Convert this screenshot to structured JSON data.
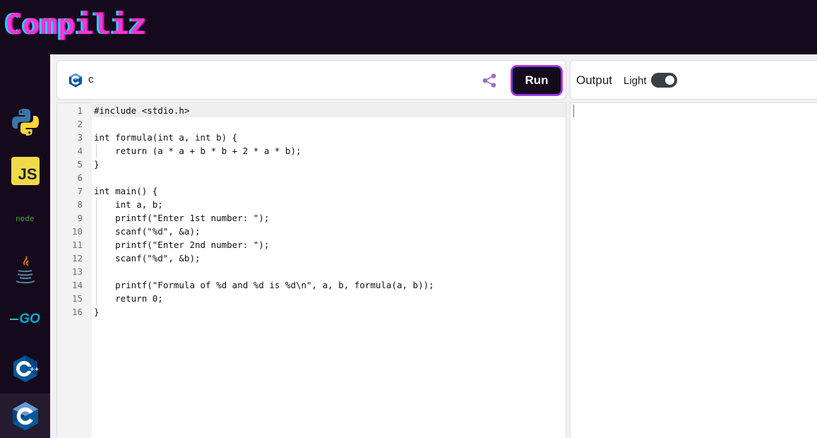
{
  "app": {
    "logo": "Compiliz"
  },
  "sidebar": {
    "items": [
      {
        "name": "python",
        "icon": "python-icon"
      },
      {
        "name": "javascript",
        "icon": "js-icon",
        "label": "JS"
      },
      {
        "name": "node",
        "icon": "node-icon",
        "label": "node"
      },
      {
        "name": "java",
        "icon": "java-icon"
      },
      {
        "name": "go",
        "icon": "go-icon",
        "label": "GO"
      },
      {
        "name": "cpp",
        "icon": "cpp-icon"
      },
      {
        "name": "c",
        "icon": "c-icon",
        "active": true
      }
    ]
  },
  "editor": {
    "language": "c",
    "run_label": "Run",
    "lines": [
      "#include <stdio.h>",
      "",
      "int formula(int a, int b) {",
      "    return (a * a + b * b + 2 * a * b);",
      "}",
      "",
      "int main() {",
      "    int a, b;",
      "    printf(\"Enter 1st number: \");",
      "    scanf(\"%d\", &a);",
      "    printf(\"Enter 2nd number: \");",
      "    scanf(\"%d\", &b);",
      "",
      "    printf(\"Formula of %d and %d is %d\\n\", a, b, formula(a, b));",
      "    return 0;",
      "}"
    ],
    "line_numbers": [
      "1",
      "2",
      "3",
      "4",
      "5",
      "6",
      "7",
      "8",
      "9",
      "10",
      "11",
      "12",
      "13",
      "14",
      "15",
      "16"
    ]
  },
  "output": {
    "title": "Output",
    "theme_label": "Light",
    "theme_toggle_on": true,
    "content": ""
  },
  "colors": {
    "brand_dark": "#150a1c",
    "logo_pink": "#ff34d2",
    "logo_cyan": "#1ad3ff",
    "share_purple": "#a66cc8"
  }
}
